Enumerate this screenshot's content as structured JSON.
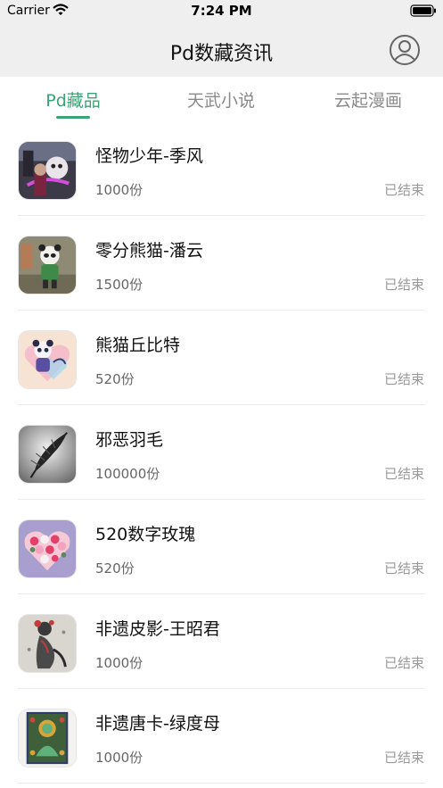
{
  "status_bar": {
    "carrier": "Carrier",
    "time": "7:24 PM"
  },
  "header": {
    "title": "Pd数藏资讯",
    "profile_icon": "user-circle-icon"
  },
  "tabs": [
    {
      "label": "Pd藏品",
      "active": true
    },
    {
      "label": "天武小说",
      "active": false
    },
    {
      "label": "云起漫画",
      "active": false
    }
  ],
  "colors": {
    "accent": "#3aa374",
    "nav_background": "#efefef"
  },
  "items": [
    {
      "name": "怪物少年-季风",
      "count": "1000份",
      "status": "已结束",
      "thumb": "monster-boy-artwork"
    },
    {
      "name": "零分熊猫-潘云",
      "count": "1500份",
      "status": "已结束",
      "thumb": "zero-panda-artwork"
    },
    {
      "name": "熊猫丘比特",
      "count": "520份",
      "status": "已结束",
      "thumb": "panda-cupid-artwork"
    },
    {
      "name": "邪恶羽毛",
      "count": "100000份",
      "status": "已结束",
      "thumb": "evil-feather-artwork"
    },
    {
      "name": "520数字玫瑰",
      "count": "520份",
      "status": "已结束",
      "thumb": "digital-rose-heart-artwork"
    },
    {
      "name": "非遗皮影-王昭君",
      "count": "1000份",
      "status": "已结束",
      "thumb": "shadow-puppet-artwork"
    },
    {
      "name": "非遗唐卡-绿度母",
      "count": "1000份",
      "status": "已结束",
      "thumb": "thangka-artwork"
    }
  ]
}
